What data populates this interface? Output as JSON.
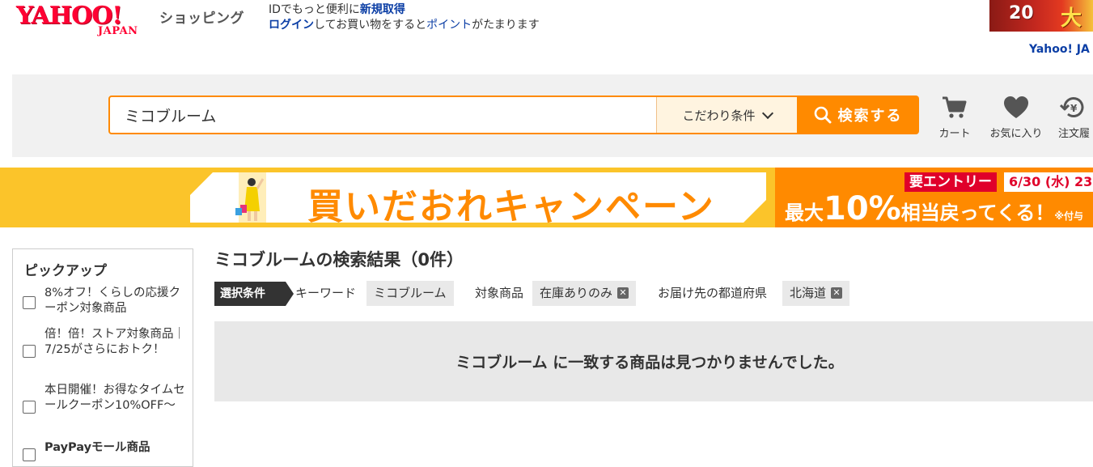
{
  "header": {
    "logo_text": "YAHOO!",
    "logo_sub": "JAPAN",
    "logo_shopping": "ショッピング",
    "login_line1_a": "IDでもっと便利に",
    "login_line1_link": "新規取得",
    "login_line2_link1": "ログイン",
    "login_line2_b": "してお買い物をすると",
    "login_line2_link2": "ポイント",
    "login_line2_c": "がたまります",
    "banner_num": "20",
    "banner_kanji": "大",
    "yahoo_link": "Yahoo! JA"
  },
  "search": {
    "value": "ミコブルーム",
    "kodawari_label": "こだわり条件",
    "button_label": "検索する"
  },
  "header_icons": {
    "cart_label": "カート",
    "favorites_label": "お気に入り",
    "history_label": "注文履"
  },
  "campaign": {
    "title": "買いだおれキャンペーン",
    "entry_tag": "要エントリー",
    "date": "6/30 (水) 23",
    "max_prefix": "最大",
    "percent": "10%",
    "suffix": "相当戻ってくる！",
    "note": "※付与"
  },
  "sidebar": {
    "title": "ピックアップ",
    "items": [
      {
        "label": "8%オフ！くらしの応援クーポン対象商品"
      },
      {
        "label": "倍！倍！ストア対象商品｜7/25がさらにおトク！"
      },
      {
        "label": "本日開催！お得なタイムセールクーポン10%OFF〜"
      },
      {
        "label": "PayPayモール商品"
      }
    ]
  },
  "results": {
    "title": "ミコブルームの検索結果（0件）",
    "cond_tag": "選択条件",
    "keyword_label": "キーワード",
    "keyword_value": "ミコブルーム",
    "target_label": "対象商品",
    "target_value": "在庫ありのみ",
    "pref_label": "お届け先の都道府県",
    "pref_value": "北海道",
    "no_result": "ミコブルーム に一致する商品は見つかりませんでした。"
  },
  "colors": {
    "accent_orange": "#ff8a00",
    "brand_red": "#ff0033",
    "link_blue": "#0b3ea5",
    "campaign_yellow": "#fbc42a"
  }
}
